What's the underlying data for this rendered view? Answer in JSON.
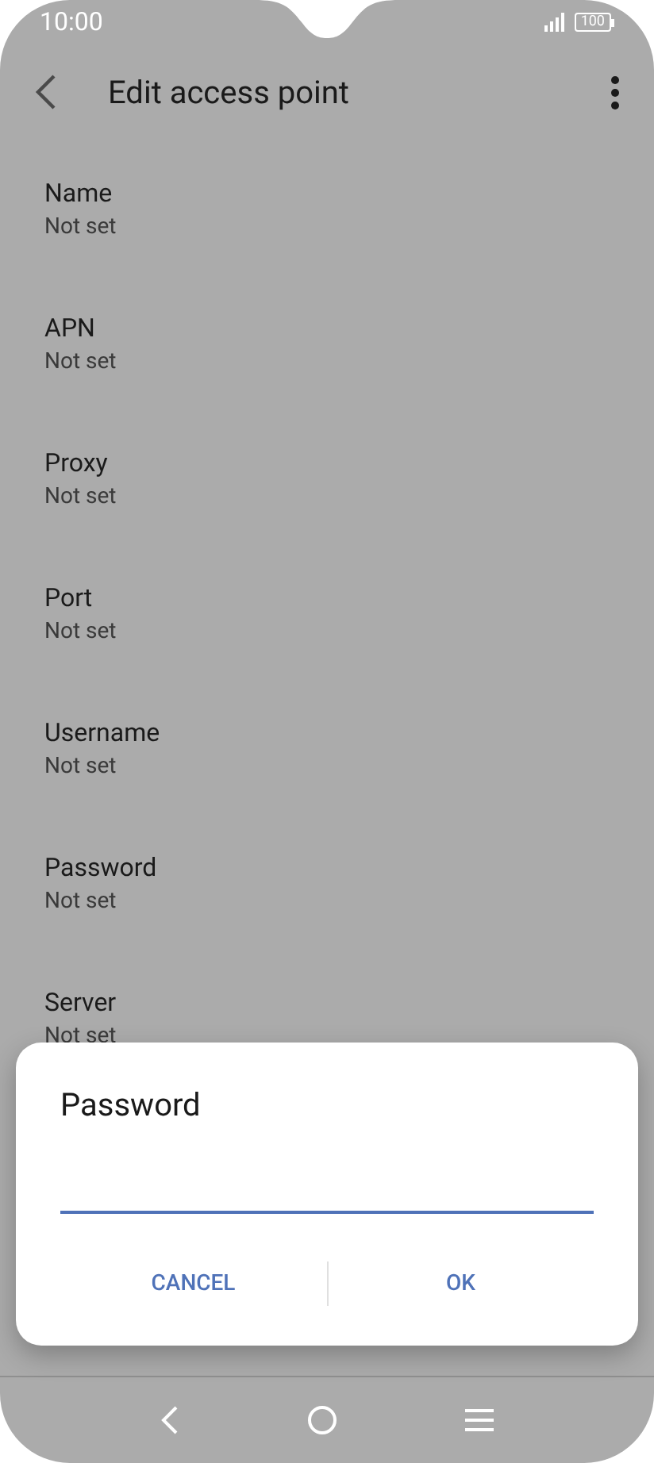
{
  "status_bar": {
    "time": "10:00",
    "battery": "100"
  },
  "header": {
    "title": "Edit access point"
  },
  "settings": [
    {
      "label": "Name",
      "value": "Not set"
    },
    {
      "label": "APN",
      "value": "Not set"
    },
    {
      "label": "Proxy",
      "value": "Not set"
    },
    {
      "label": "Port",
      "value": "Not set"
    },
    {
      "label": "Username",
      "value": "Not set"
    },
    {
      "label": "Password",
      "value": "Not set"
    },
    {
      "label": "Server",
      "value": "Not set"
    }
  ],
  "dialog": {
    "title": "Password",
    "buttons": [
      "CANCEL",
      "OK"
    ]
  }
}
